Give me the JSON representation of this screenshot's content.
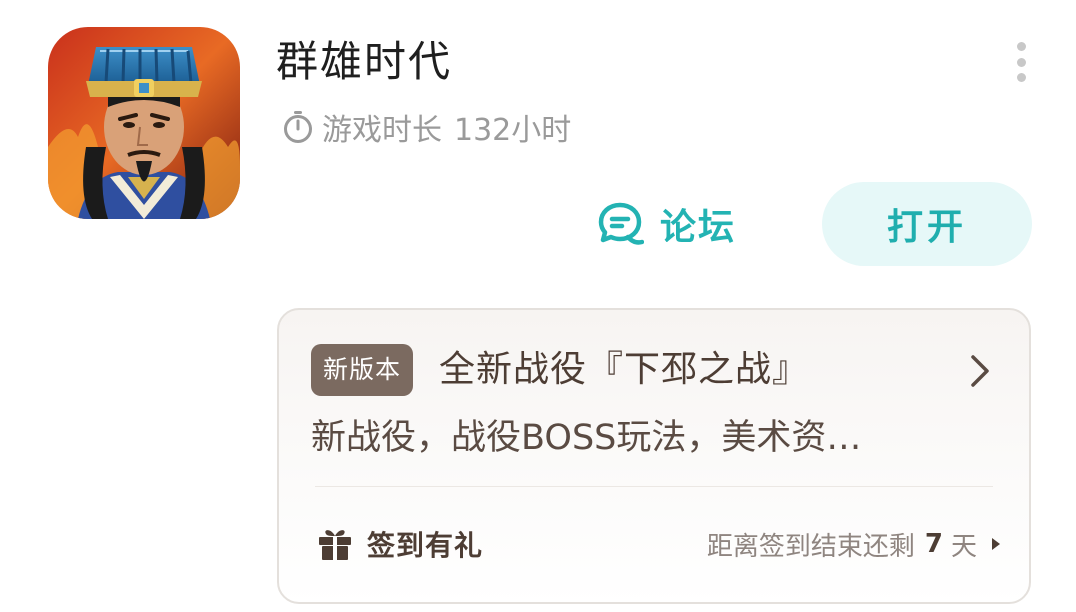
{
  "app": {
    "title": "群雄时代",
    "icon": "portrait-warrior-icon",
    "playtime_label": "游戏时长",
    "playtime_value": "132小时"
  },
  "actions": {
    "forum_label": "论坛",
    "open_label": "打开",
    "accent_color": "#23b3b3"
  },
  "news": {
    "badge": "新版本",
    "title": "全新战役『下邳之战』",
    "description": "新战役，战役BOSS玩法，美术资…"
  },
  "checkin": {
    "label": "签到有礼",
    "countdown_prefix": "距离签到结束还剩",
    "days": "7",
    "unit": "天"
  }
}
